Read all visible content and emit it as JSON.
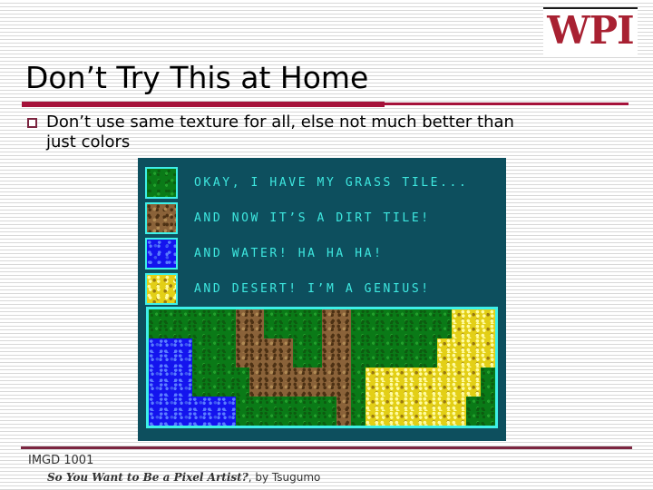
{
  "logo": {
    "text": "WPI",
    "color": "#a82132"
  },
  "slide": {
    "title": "Don’t Try This at Home",
    "accent_color": "#a5123a",
    "bullet": {
      "marker": "hollow-square",
      "text": "Don’t use same texture for all, else not much better than just colors"
    }
  },
  "panel": {
    "background_color": "#0d4f5e",
    "border_color": "#3ef0e8",
    "legend": [
      {
        "swatch": "grass-tile-swatch",
        "tile": "grass",
        "color": "#0a7a17",
        "label": "OKAY, I HAVE MY GRASS TILE..."
      },
      {
        "swatch": "dirt-tile-swatch",
        "tile": "dirt",
        "color": "#8a6239",
        "label": "AND NOW IT’S A DIRT TILE!"
      },
      {
        "swatch": "water-tile-swatch",
        "tile": "water",
        "color": "#1414ee",
        "label": "AND WATER! HA HA HA!"
      },
      {
        "swatch": "desert-tile-swatch",
        "tile": "desert",
        "color": "#e3cf16",
        "label": "AND DESERT!  I’M A GENIUS!"
      }
    ],
    "map": {
      "columns": 24,
      "rows": 8,
      "tile_colors": {
        "g": "#0a7a17",
        "d": "#8a6239",
        "w": "#1414ee",
        "s": "#e3cf16"
      },
      "rows_data": [
        "ggggggddggggddgggggggsss",
        "ggggggddggggddgggggggsss",
        "wwwgggddddggddggggggssss",
        "wwwgggddddggddggggggssss",
        "wwwggggdddddddgssssssssg",
        "wwwggggdddddddgssssssssg",
        "wwwwwwgggggggdgsssssssgg",
        "wwwwwwgggggggdgsssssssgg"
      ]
    }
  },
  "footer": {
    "course": "IMGD 1001",
    "credit_title": "So You Want to Be a Pixel Artist?",
    "credit_rest": ", by Tsugumo"
  }
}
